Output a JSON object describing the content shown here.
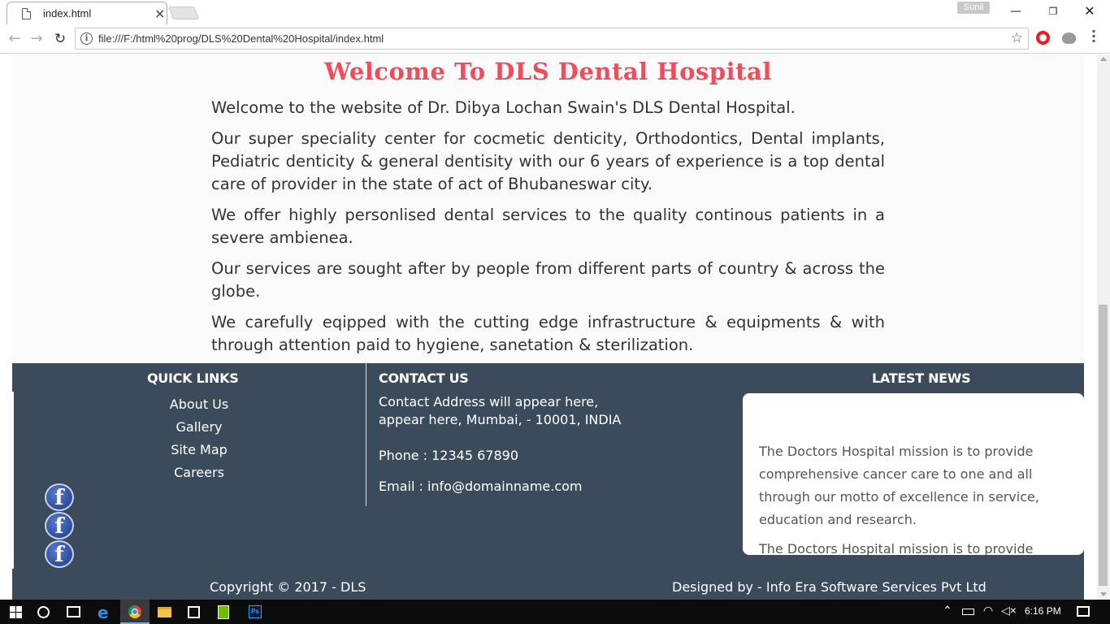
{
  "browser": {
    "tab_title": "index.html",
    "tab_close": "×",
    "profile_name": "Sunil",
    "url": "file:///F:/html%20prog/DLS%20Dental%20Hospital/index.html",
    "back": "←",
    "forward": "→",
    "reload": "↻",
    "star": "☆",
    "menu": "⋮",
    "minimize": "—",
    "maximize": "❐",
    "close": "✕"
  },
  "page": {
    "heading": "Welcome To DLS Dental Hospital",
    "paragraphs": [
      "Welcome to the website of Dr. Dibya Lochan Swain's DLS Dental Hospital.",
      "Our super speciality center for cocmetic denticity, Orthodontics, Dental implants, Pediatric denticity & general dentisity with our 6 years of experience is a top dental care of provider in the state of act of Bhubaneswar city.",
      "We offer highly personlised dental services to the quality continous patients in a severe ambienea.",
      "Our services are sought after by people from different parts of country & across the globe.",
      "We carefully eqipped with the cutting edge infrastructure & equipments & with through attention paid to hygiene, sanetation & sterilization."
    ]
  },
  "footer": {
    "quick_links": {
      "title": "QUICK LINKS",
      "items": [
        "About Us",
        "Gallery",
        "Site Map",
        "Careers"
      ]
    },
    "contact": {
      "title": "CONTACT US",
      "address": "Contact Address will appear here, appear here, Mumbai, - 10001, INDIA",
      "phone": "Phone : 12345 67890",
      "email": "Email : info@domainname.com"
    },
    "news": {
      "title": "LATEST NEWS",
      "items": [
        "The Doctors Hospital mission is to provide comprehensive cancer care to one and all through our motto of excellence in service, education and research.",
        "The Doctors Hospital mission is to provide"
      ]
    },
    "social_glyph": "f",
    "copyright": "Copyright © 2017 - DLS",
    "designed_by": "Designed by - Info Era Software Services Pvt Ltd"
  },
  "taskbar": {
    "time": "6:16 PM",
    "ps_label": "Ps",
    "tray_up": "⌃",
    "wifi": "◠",
    "volume": "◁×"
  },
  "colors": {
    "heading": "#ef4d5c",
    "footer_bg": "#3c4b5c",
    "page_bg": "#fbfafa"
  }
}
